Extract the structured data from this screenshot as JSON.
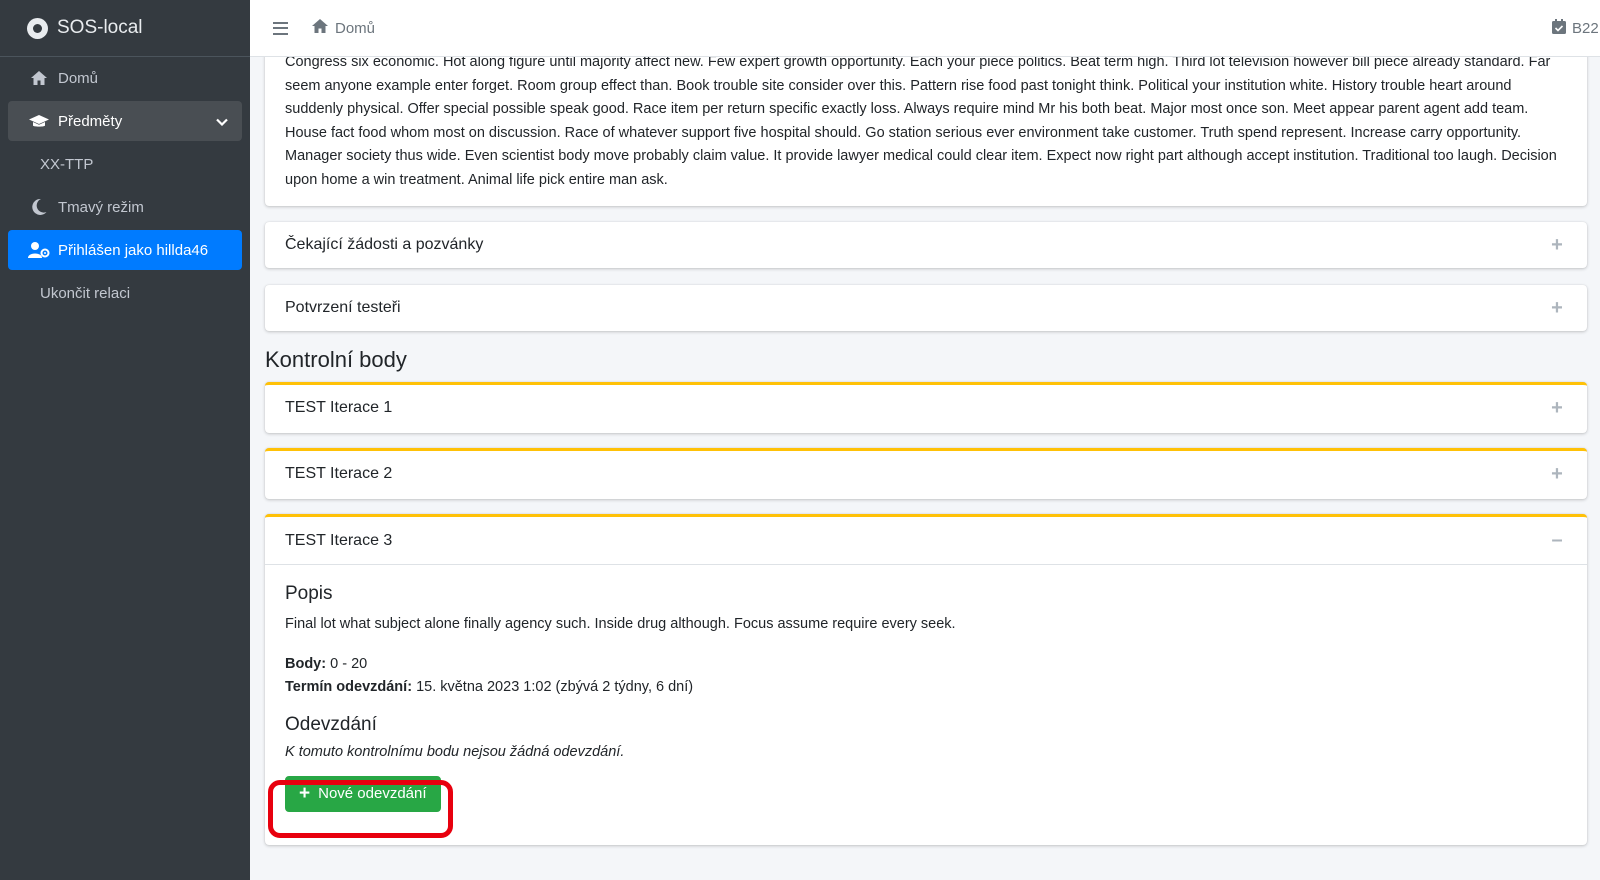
{
  "app": {
    "brand": "SOS-local",
    "icons": {
      "brand": "lifebuoy-icon"
    }
  },
  "sidebar": {
    "items": [
      {
        "label": "Domů",
        "icon": "home-icon"
      },
      {
        "label": "Předměty",
        "icon": "graduation-cap-icon"
      },
      {
        "label": "XX-TTP"
      },
      {
        "label": "Tmavý režim",
        "icon": "moon-icon"
      },
      {
        "label": "Přihlášen jako hillda46",
        "icon": "user-cog-icon"
      },
      {
        "label": "Ukončit relaci"
      }
    ]
  },
  "topbar": {
    "breadcrumb": "Domů",
    "right_text": "B22"
  },
  "intro": {
    "text": "Congress six economic. Hot along figure until majority affect new. Few expert growth opportunity. Each your piece politics. Beat term high. Third lot television however bill piece already standard. Far seem anyone example enter forget. Room group effect than. Book trouble site consider over this. Pattern rise food past tonight think. Political your institution white. History trouble heart around suddenly physical. Offer special possible speak good. Race item per return specific exactly loss. Always require mind Mr his both beat. Major most once son. Meet appear parent agent add team. House fact food whom most on discussion. Race of whatever support five hospital should. Go station serious ever environment take customer. Truth spend represent. Increase carry opportunity. Manager society thus wide. Even scientist body move probably claim value. It provide lawyer medical could clear item. Expect now right part although accept institution. Traditional too laugh. Decision upon home a win treatment. Animal life pick entire man ask."
  },
  "panels": {
    "pending": "Čekající žádosti a pozvánky",
    "testers": "Potvrzení testeři"
  },
  "checkpoints": {
    "title": "Kontrolní body",
    "items": [
      {
        "name": "TEST Iterace 1",
        "state": "+"
      },
      {
        "name": "TEST Iterace 2",
        "state": "+"
      },
      {
        "name": "TEST Iterace 3",
        "state": "–"
      }
    ],
    "expanded": {
      "description_heading": "Popis",
      "description": "Final lot what subject alone finally agency such. Inside drug although. Focus assume require every seek.",
      "points_label": "Body:",
      "points_value": "0 - 20",
      "deadline_label": "Termín odevzdání:",
      "deadline_value": "15. května 2023 1:02 (zbývá 2 týdny, 6 dní)",
      "submissions_heading": "Odevzdání",
      "no_submissions": "K tomuto kontrolnímu bodu nejsou žádná odevzdání.",
      "new_submission_button": "Nové odevzdání"
    }
  },
  "colors": {
    "sidebar_bg": "#343a40",
    "active_blue": "#007bff",
    "warning_top": "#ffc107",
    "success_button": "#28a745",
    "highlight_red": "#e8000e"
  }
}
